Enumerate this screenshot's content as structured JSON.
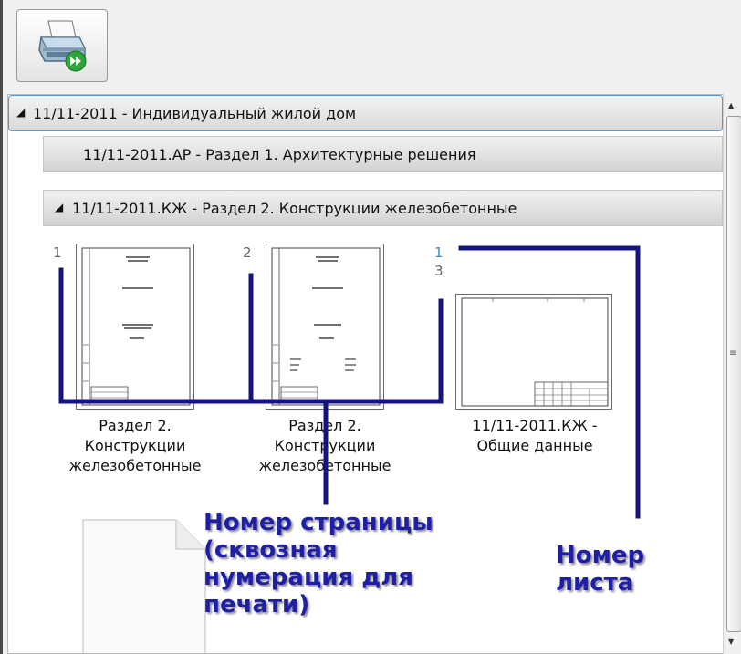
{
  "toolbar": {
    "print_icon": "printer-icon"
  },
  "tree": {
    "root": {
      "label": "11/11-2011 - Индивидуальный жилой дом",
      "expanded": true
    },
    "sections": [
      {
        "label": "11/11-2011.АР - Раздел 1. Архитектурные решения",
        "expanded": false
      },
      {
        "label": "11/11-2011.КЖ - Раздел 2. Конструкции железобетонные",
        "expanded": true
      }
    ]
  },
  "pages": [
    {
      "page_number": "1",
      "caption": [
        "Раздел 2.",
        "Конструкции",
        "железобетонные"
      ]
    },
    {
      "page_number": "2",
      "caption": [
        "Раздел 2.",
        "Конструкции",
        "железобетонные"
      ]
    },
    {
      "sheet_number": "1",
      "page_number": "3",
      "caption": [
        "11/11-2011.КЖ -",
        "Общие данные"
      ]
    }
  ],
  "annotations": {
    "page_number_note": [
      "Номер страницы",
      "(сквозная",
      "нумерация для",
      "печати)"
    ],
    "sheet_number_note": [
      "Номер",
      "листа"
    ],
    "color": "#1e1fa6",
    "line_color": "#14147e"
  }
}
